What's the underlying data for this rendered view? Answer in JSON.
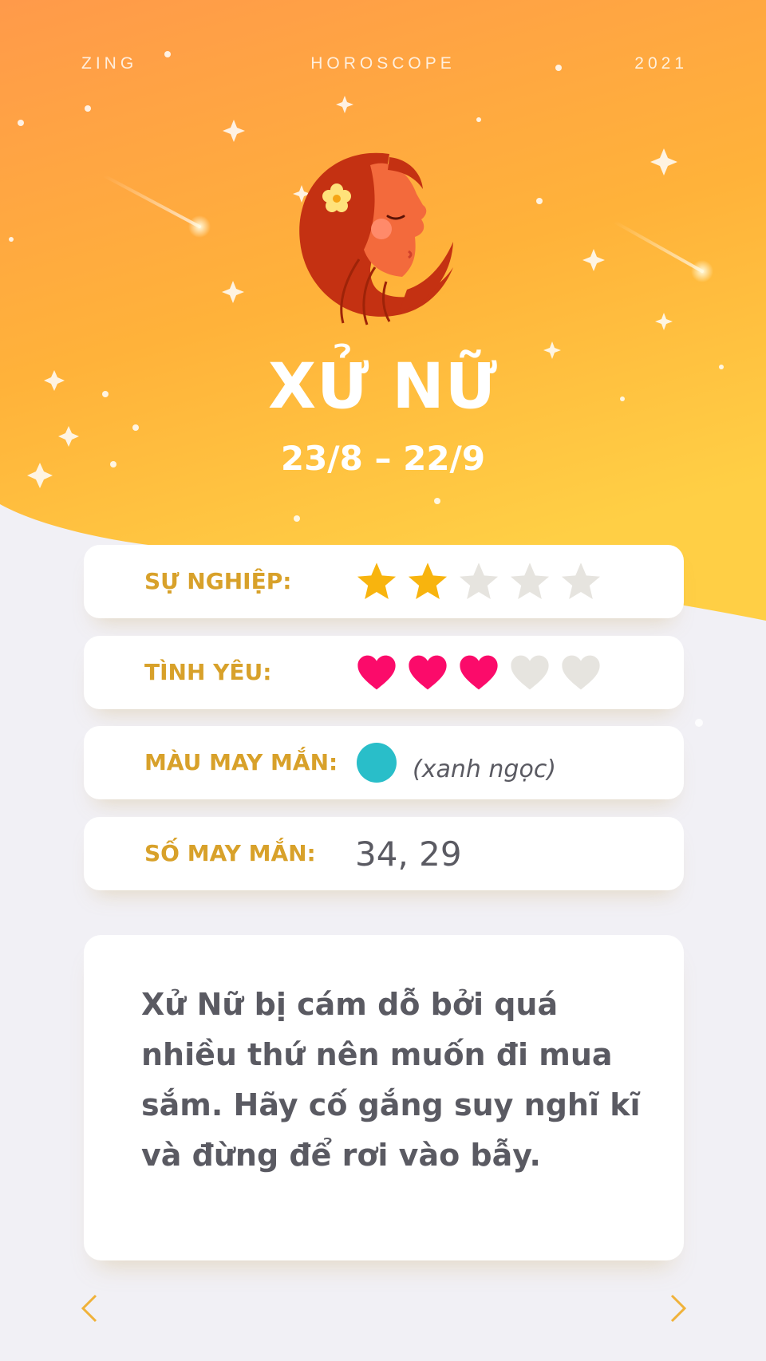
{
  "header": {
    "left": "ZING",
    "center": "HOROSCOPE",
    "right": "2021"
  },
  "sign": {
    "name": "XỬ NỮ",
    "dates": "23/8 – 22/9",
    "icon": "virgo-woman-icon"
  },
  "ratings": {
    "career": {
      "label": "SỰ NGHIỆP:",
      "score": 2,
      "max": 5,
      "icon": "star-icon"
    },
    "love": {
      "label": "TÌNH YÊU:",
      "score": 3,
      "max": 5,
      "icon": "heart-icon"
    }
  },
  "lucky_color": {
    "label": "MÀU MAY MẮN:",
    "color_hex": "#29bec9",
    "name": "(xanh ngọc)"
  },
  "lucky_number": {
    "label": "SỐ MAY MẮN:",
    "value": "34, 29"
  },
  "description": "Xử Nữ bị cám dỗ bởi quá nhiều thứ nên muốn đi mua sắm. Hãy cố gắng suy nghĩ kĩ và đừng để rơi vào bẫy.",
  "colors": {
    "accent_label": "#d8a12a",
    "star_filled": "#f8b40e",
    "heart_filled": "#fb0b6a",
    "empty": "#e6e4df",
    "arrow": "#f0b23a"
  },
  "nav": {
    "prev_icon": "chevron-left-icon",
    "next_icon": "chevron-right-icon"
  }
}
